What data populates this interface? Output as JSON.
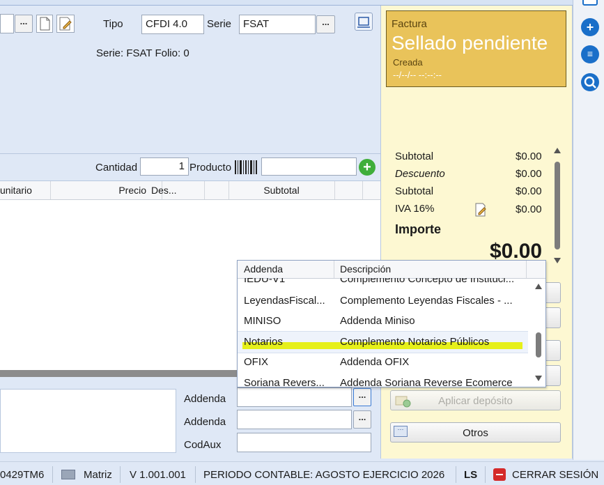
{
  "header": {
    "tipo_label": "Tipo",
    "tipo_value": "CFDI 4.0",
    "serie_label": "Serie",
    "serie_value": "FSAT",
    "serie_folio": "Serie: FSAT Folio: 0",
    "dots": "..."
  },
  "status": {
    "doc_type": "Factura",
    "state": "Sellado pendiente",
    "sub_state": "Creada",
    "datetime": "--/--/-- --:--:--"
  },
  "entry": {
    "cantidad_label": "Cantidad",
    "cantidad_value": "1",
    "producto_label": "Producto",
    "producto_value": ""
  },
  "grid": {
    "columns": [
      "unitario",
      "Precio",
      "Des...",
      "Subtotal"
    ]
  },
  "totals": {
    "rows": [
      {
        "label": "Subtotal",
        "value": "$0.00"
      },
      {
        "label": "Descuento",
        "value": "$0.00"
      },
      {
        "label": "Subtotal",
        "value": "$0.00"
      },
      {
        "label": "IVA 16%",
        "value": "$0.00"
      }
    ],
    "importe_label": "Importe",
    "importe_value": "$0.00"
  },
  "addenda_dropdown": {
    "col_addenda": "Addenda",
    "col_descripcion": "Descripción",
    "rows": [
      {
        "addenda": "IEDU-V1",
        "descripcion": "Complemento Concepto de Instituci..."
      },
      {
        "addenda": "LeyendasFiscal...",
        "descripcion": "Complemento Leyendas Fiscales - ..."
      },
      {
        "addenda": "MINISO",
        "descripcion": "Addenda Miniso"
      },
      {
        "addenda": "Notarios",
        "descripcion": "Complemento Notarios Públicos"
      },
      {
        "addenda": "OFIX",
        "descripcion": "Addenda OFIX"
      },
      {
        "addenda": "Soriana Revers...",
        "descripcion": "Addenda Soriana Reverse Ecomerce"
      }
    ],
    "highlight_color": "#e6f01a"
  },
  "bottom_fields": {
    "addenda1_label": "Addenda",
    "addenda2_label": "Addenda",
    "codaux_label": "CodAux"
  },
  "actions": {
    "aplicar_deposito": "Aplicar depósito",
    "otros": "Otros"
  },
  "footer": {
    "code": "0429TM6",
    "branch": "Matriz",
    "version": "V 1.001.001",
    "periodo": "PERIODO CONTABLE: AGOSTO EJERCICIO 2026",
    "user": "LS",
    "logout": "CERRAR SESIÓN"
  },
  "colors": {
    "accent": "#1a6fc9",
    "status_card": "#e9c35a",
    "totals_panel": "#fdf8d2"
  }
}
